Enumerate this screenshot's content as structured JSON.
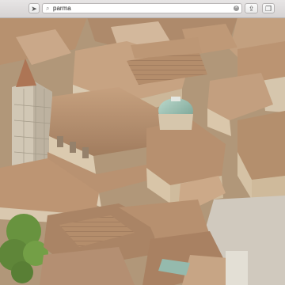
{
  "toolbar": {
    "location_icon": "location-arrow-icon",
    "search_icon": "magnifier-icon",
    "search_value": "parma",
    "clear_icon": "clear-x-icon",
    "share_icon": "share-icon",
    "bookmark_icon": "bookmark-icon"
  },
  "map": {
    "view": "3d-flyover-satellite",
    "colors": {
      "roof": "#b48a66",
      "facade": "#d8c7ad",
      "dome": "#8fb6a8",
      "tree": "#5d8b34",
      "square": "#cfc8bd"
    }
  }
}
